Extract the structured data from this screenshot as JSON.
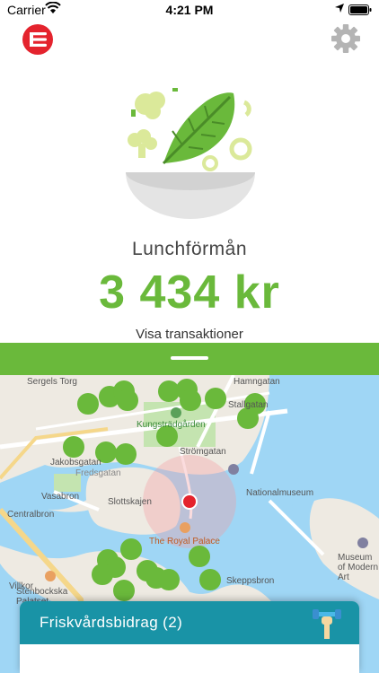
{
  "status_bar": {
    "carrier": "Carrier",
    "time": "4:21 PM"
  },
  "icons": {
    "logo": "edenred-logo",
    "settings": "gear-icon",
    "hero": "salad-bowl-icon",
    "card": "dumbbell-hand-icon"
  },
  "colors": {
    "brand_green": "#6ab93b",
    "brand_red": "#e4232d",
    "card_teal": "#1993a6"
  },
  "main": {
    "title": "Lunchförmån",
    "amount": "3 434 kr",
    "link": "Visa transaktioner"
  },
  "map": {
    "labels": [
      "Sergels Torg",
      "Kungsträdgården",
      "Stallgatan",
      "Strömgatan",
      "Jakobsgatan",
      "Fredsgatan",
      "Nationalmuseum",
      "Centralbron",
      "Vasabron",
      "Slottskajen",
      "The Royal Palace",
      "Museum of Modern Art",
      "Villkor",
      "Stenbockska Palatset",
      "Skeppsbron",
      "Hamngatan"
    ]
  },
  "card": {
    "title": "Friskvårdsbidrag (2)"
  }
}
